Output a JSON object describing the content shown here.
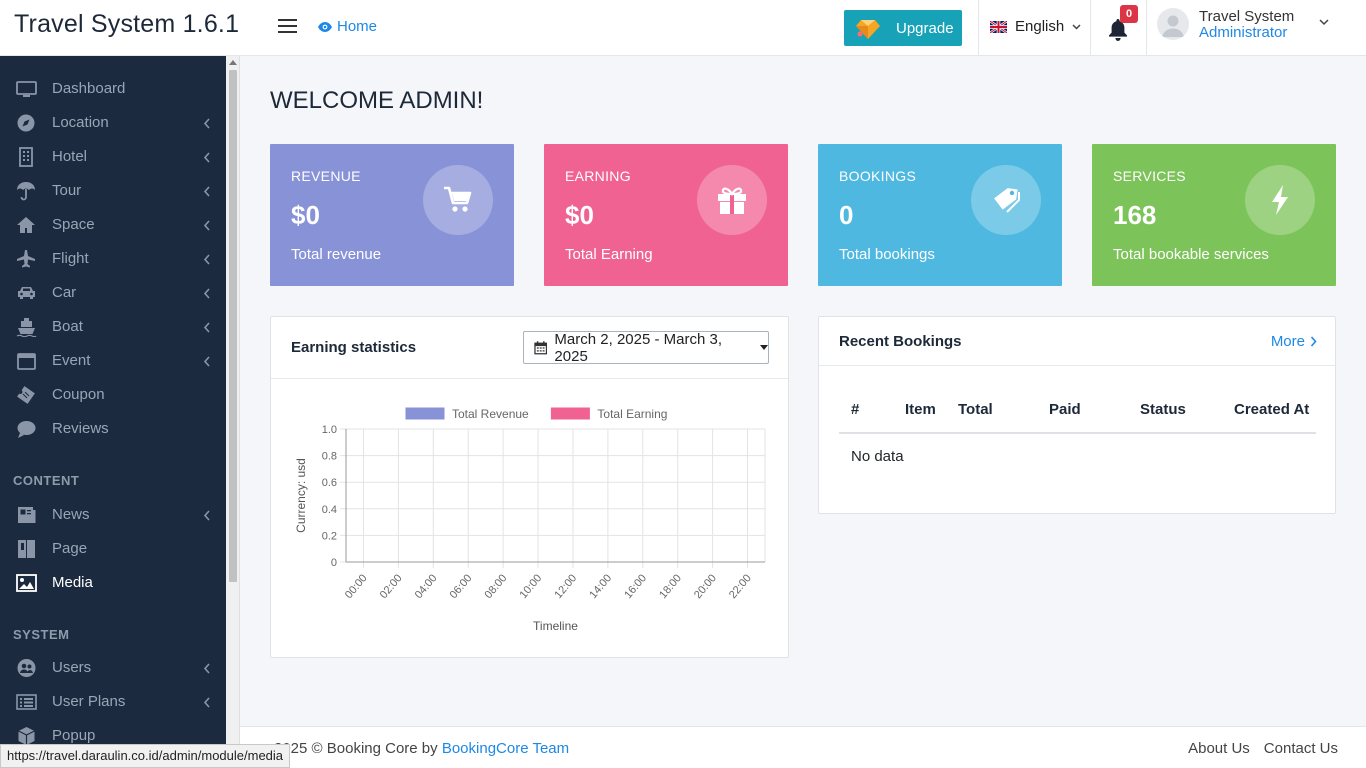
{
  "header": {
    "brand": "Travel System 1.6.1",
    "home_label": "Home",
    "upgrade_label": "Upgrade",
    "language": "English",
    "notification_count": "0",
    "user_name": "Travel System",
    "user_role": "Administrator"
  },
  "sidebar": {
    "items": [
      {
        "label": "Dashboard",
        "icon": "monitor-icon",
        "has_submenu": false
      },
      {
        "label": "Location",
        "icon": "compass-icon",
        "has_submenu": true
      },
      {
        "label": "Hotel",
        "icon": "building-icon",
        "has_submenu": true
      },
      {
        "label": "Tour",
        "icon": "umbrella-icon",
        "has_submenu": true
      },
      {
        "label": "Space",
        "icon": "home-icon",
        "has_submenu": true
      },
      {
        "label": "Flight",
        "icon": "plane-icon",
        "has_submenu": true
      },
      {
        "label": "Car",
        "icon": "car-icon",
        "has_submenu": true
      },
      {
        "label": "Boat",
        "icon": "ship-icon",
        "has_submenu": true
      },
      {
        "label": "Event",
        "icon": "calendar-icon",
        "has_submenu": true
      },
      {
        "label": "Coupon",
        "icon": "ticket-icon",
        "has_submenu": false
      },
      {
        "label": "Reviews",
        "icon": "comment-icon",
        "has_submenu": false
      }
    ],
    "content_section": "CONTENT",
    "content_items": [
      {
        "label": "News",
        "icon": "newspaper-icon",
        "has_submenu": true
      },
      {
        "label": "Page",
        "icon": "book-icon",
        "has_submenu": false
      },
      {
        "label": "Media",
        "icon": "image-icon",
        "has_submenu": false,
        "active": true
      }
    ],
    "system_section": "SYSTEM",
    "system_items": [
      {
        "label": "Users",
        "icon": "users-icon",
        "has_submenu": true
      },
      {
        "label": "User Plans",
        "icon": "list-icon",
        "has_submenu": true
      },
      {
        "label": "Popup",
        "icon": "cube-icon",
        "has_submenu": false
      }
    ]
  },
  "main": {
    "welcome": "WELCOME ADMIN!",
    "cards": [
      {
        "title": "REVENUE",
        "value": "$0",
        "desc": "Total revenue",
        "color": "#8892d6",
        "icon": "cart-icon"
      },
      {
        "title": "EARNING",
        "value": "$0",
        "desc": "Total Earning",
        "color": "#f06292",
        "icon": "gift-icon"
      },
      {
        "title": "BOOKINGS",
        "value": "0",
        "desc": "Total bookings",
        "color": "#4fb8e0",
        "icon": "tags-icon"
      },
      {
        "title": "SERVICES",
        "value": "168",
        "desc": "Total bookable services",
        "color": "#7cc35a",
        "icon": "bolt-icon"
      }
    ],
    "earning": {
      "title": "Earning statistics",
      "date_range": "March 2, 2025 - March 3, 2025"
    },
    "recent": {
      "title": "Recent Bookings",
      "more_label": "More",
      "columns": [
        "#",
        "Item",
        "Total",
        "Paid",
        "Status",
        "Created At"
      ],
      "empty": "No data"
    }
  },
  "chart_data": {
    "type": "line",
    "title": "",
    "xlabel": "Timeline",
    "ylabel": "Currency: usd",
    "categories": [
      "00:00",
      "02:00",
      "04:00",
      "06:00",
      "08:00",
      "10:00",
      "12:00",
      "14:00",
      "16:00",
      "18:00",
      "20:00",
      "22:00"
    ],
    "y_ticks": [
      "1.0",
      "0.8",
      "0.6",
      "0.4",
      "0.2",
      "0"
    ],
    "ylim": [
      0,
      1
    ],
    "grid": true,
    "legend_position": "top",
    "series": [
      {
        "name": "Total Revenue",
        "color": "#8892d6",
        "values": []
      },
      {
        "name": "Total Earning",
        "color": "#f06292",
        "values": []
      }
    ]
  },
  "footer": {
    "copyright_prefix": "2025 © Booking Core by",
    "team_link": "BookingCore Team",
    "links": [
      "About Us",
      "Contact Us"
    ]
  },
  "status_url": "https://travel.daraulin.co.id/admin/module/media"
}
